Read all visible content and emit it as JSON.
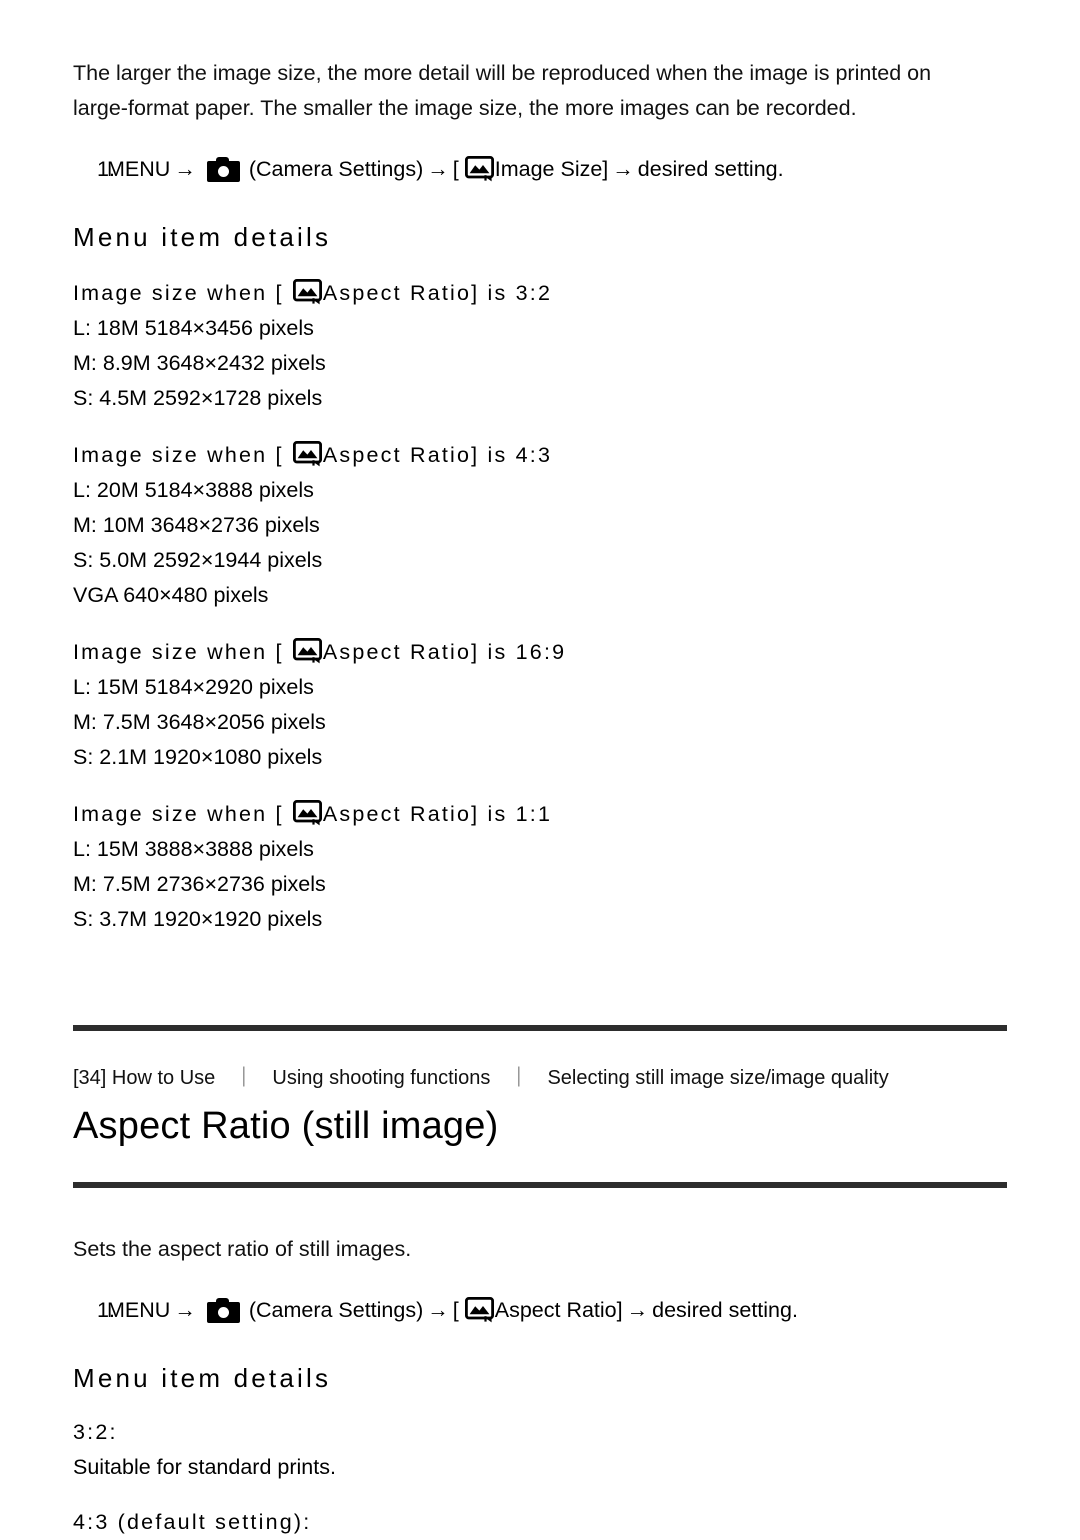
{
  "icons": {
    "camera": "camera-icon",
    "picture": "picture-icon"
  },
  "glyphs": {
    "arrow": "→",
    "bracket_open": "[",
    "bracket_close": "]",
    "separator": "｜"
  },
  "top_section": {
    "intro_paragraph": "The larger the image size, the more detail will be reproduced when the image is printed on large-format paper. The smaller the image size, the more images can be recorded.",
    "step": {
      "number": "1.",
      "menu_label": "MENU",
      "camera_settings_label": "(Camera Settings)",
      "setting_name": "Image Size]",
      "tail": "desired setting."
    },
    "menu_item_details_heading": "Menu item details",
    "groups": [
      {
        "heading_prefix": "Image size when [",
        "heading_setting": "Aspect Ratio]",
        "heading_suffix": "is 3:2",
        "lines": [
          "L: 18M 5184×3456 pixels",
          "M: 8.9M 3648×2432 pixels",
          "S: 4.5M 2592×1728 pixels"
        ]
      },
      {
        "heading_prefix": "Image size when [",
        "heading_setting": "Aspect Ratio]",
        "heading_suffix": "is 4:3",
        "lines": [
          "L: 20M 5184×3888 pixels",
          "M: 10M 3648×2736 pixels",
          "S: 5.0M 2592×1944 pixels",
          "VGA 640×480 pixels"
        ]
      },
      {
        "heading_prefix": "Image size when [",
        "heading_setting": "Aspect Ratio]",
        "heading_suffix": "is 16:9",
        "lines": [
          "L: 15M 5184×2920 pixels",
          "M: 7.5M 3648×2056 pixels",
          "S: 2.1M 1920×1080 pixels"
        ]
      },
      {
        "heading_prefix": "Image size when [",
        "heading_setting": "Aspect Ratio]",
        "heading_suffix": "is 1:1",
        "lines": [
          "L: 15M 3888×3888 pixels",
          "M: 7.5M 2736×2736 pixels",
          "S: 3.7M 1920×1920 pixels"
        ]
      }
    ]
  },
  "article": {
    "breadcrumb": {
      "item1": "[34] How to Use",
      "item2": "Using shooting functions",
      "item3": "Selecting still image size/image quality"
    },
    "title": "Aspect Ratio (still image)",
    "description": "Sets the aspect ratio of still images.",
    "step": {
      "number": "1.",
      "menu_label": "MENU",
      "camera_settings_label": "(Camera Settings)",
      "setting_name": "Aspect Ratio]",
      "tail": "desired setting."
    },
    "menu_item_details_heading": "Menu item details",
    "options": [
      {
        "label": "3:2:",
        "description": "Suitable for standard prints."
      },
      {
        "label": "4:3 (default setting):",
        "description": ""
      }
    ]
  },
  "colors": {
    "rule": "#2d2d2d",
    "text": "#000000",
    "background": "#ffffff"
  }
}
